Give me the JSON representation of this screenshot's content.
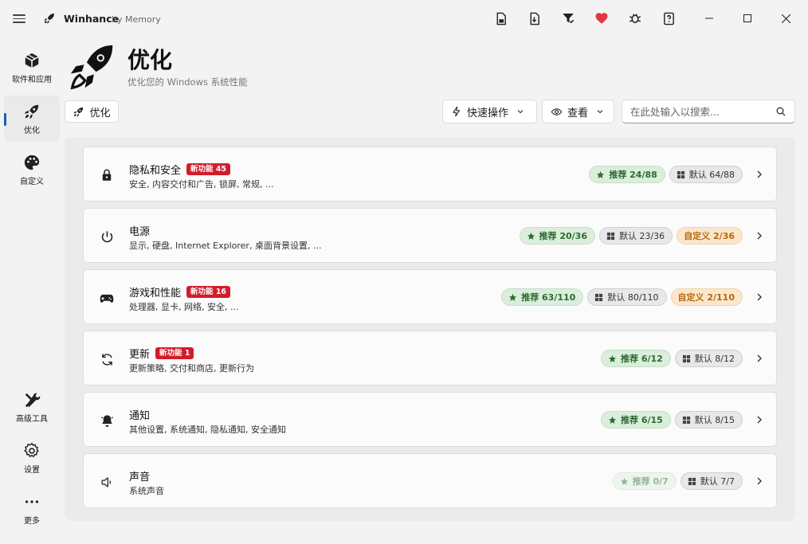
{
  "app": {
    "title": "Winhance",
    "subtitle": "by Memory"
  },
  "nav": {
    "items": [
      {
        "label": "软件和应用",
        "icon": "package-icon"
      },
      {
        "label": "优化",
        "icon": "rocket-icon",
        "active": true
      },
      {
        "label": "自定义",
        "icon": "palette-icon"
      },
      {
        "label": "高级工具",
        "icon": "tools-icon"
      },
      {
        "label": "设置",
        "icon": "gear-icon"
      },
      {
        "label": "更多",
        "icon": "more-icon"
      }
    ]
  },
  "page": {
    "title": "优化",
    "subtitle": "优化您的 Windows 系统性能"
  },
  "toolbar": {
    "crumb_label": "优化",
    "quick_actions_label": "快速操作",
    "view_label": "查看",
    "search_placeholder": "在此处输入以搜索..."
  },
  "cards": [
    {
      "title": "隐私和安全",
      "new_badge": "新功能 45",
      "desc": "安全, 内容交付和广告, 锁屏, 常规, ...",
      "icon": "lock-icon",
      "recommended": "推荐 24/88",
      "default": "默认 64/88",
      "custom": ""
    },
    {
      "title": "电源",
      "new_badge": "",
      "desc": "显示, 硬盘, Internet Explorer, 桌面背景设置, ...",
      "icon": "power-icon",
      "recommended": "推荐 20/36",
      "default": "默认 23/36",
      "custom": "自定义 2/36"
    },
    {
      "title": "游戏和性能",
      "new_badge": "新功能 16",
      "desc": "处理器, 显卡, 网络, 安全, ...",
      "icon": "gamepad-icon",
      "recommended": "推荐 63/110",
      "default": "默认 80/110",
      "custom": "自定义 2/110"
    },
    {
      "title": "更新",
      "new_badge": "新功能 1",
      "desc": "更新策略, 交付和商店, 更新行为",
      "icon": "refresh-icon",
      "recommended": "推荐 6/12",
      "default": "默认 8/12",
      "custom": ""
    },
    {
      "title": "通知",
      "new_badge": "",
      "desc": "其他设置, 系统通知, 隐私通知, 安全通知",
      "icon": "bell-icon",
      "recommended": "推荐 6/15",
      "default": "默认 8/15",
      "custom": ""
    },
    {
      "title": "声音",
      "new_badge": "",
      "desc": "系统声音",
      "icon": "speaker-icon",
      "recommended": "推荐 0/7",
      "default": "默认 7/7",
      "custom": ""
    }
  ],
  "colors": {
    "accent": "#1a5fb4",
    "new_badge": "#d31c2a",
    "recommended": "#2c6b2f",
    "custom": "#b5690b",
    "favorite": "#e0393e"
  }
}
